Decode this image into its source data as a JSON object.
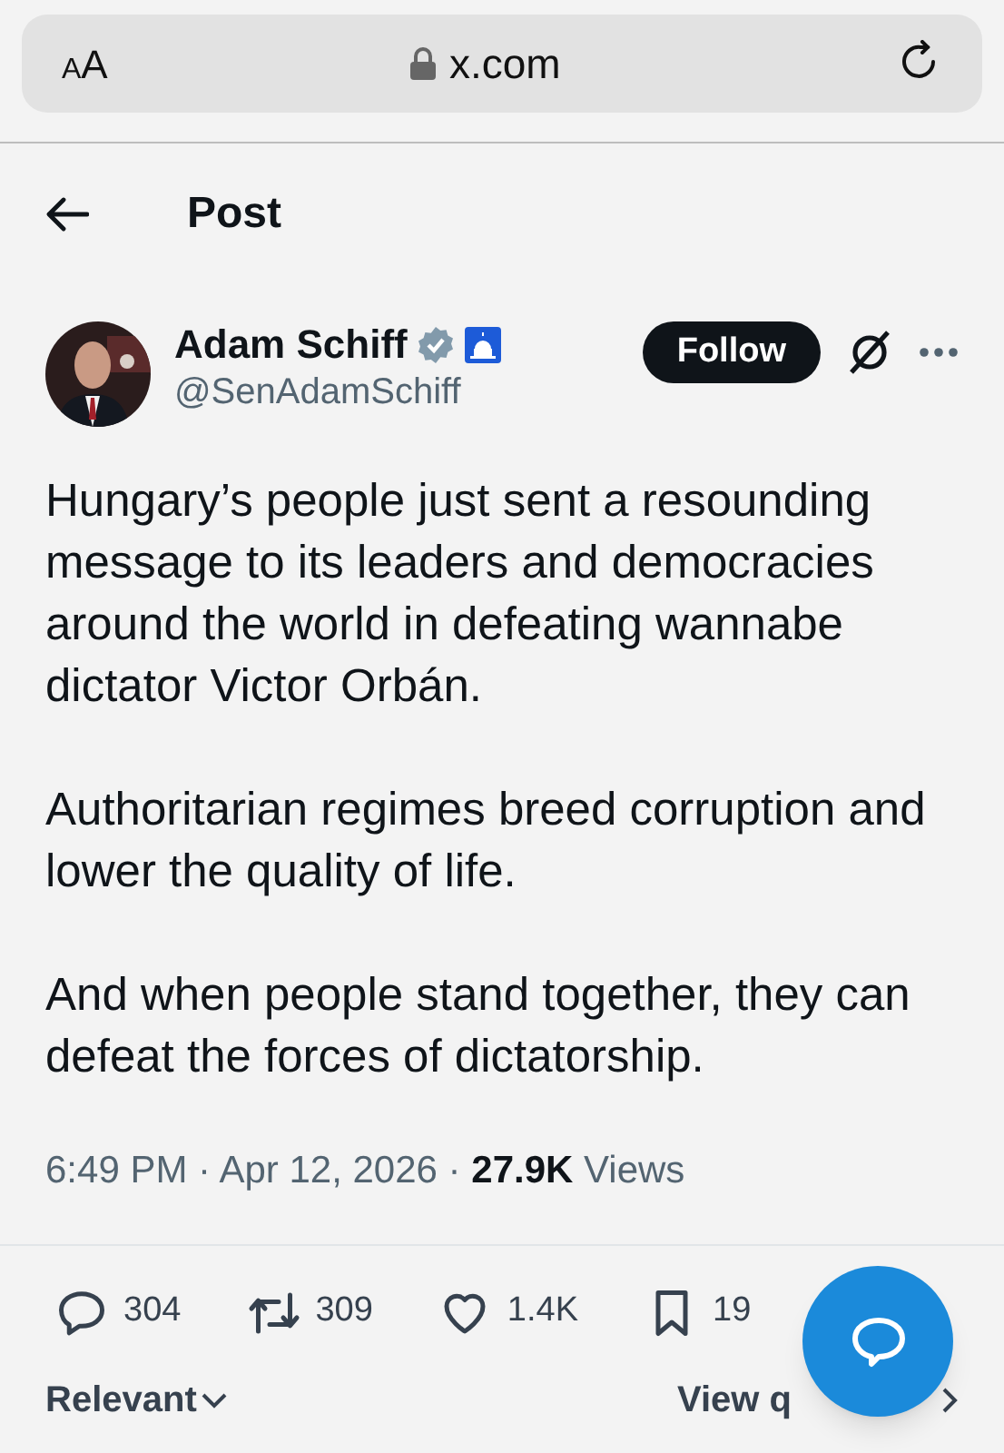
{
  "browser": {
    "text_size": "AA",
    "url": "x.com"
  },
  "header": {
    "title": "Post"
  },
  "author": {
    "name": "Adam Schiff",
    "handle": "@SenAdamSchiff",
    "follow": "Follow",
    "verified": true
  },
  "post": {
    "paragraphs": [
      "Hungary’s people just sent a resounding message to its leaders and democracies around the world in defeating wannabe dictator Victor Orbán.",
      "Authoritarian regimes breed corruption and lower the quality of life.",
      "And when people stand together, they can defeat the forces of dictatorship."
    ],
    "time": "6:49 PM · Apr 12, 2026 · ",
    "views_count": "27.9K",
    "views_label": " Views"
  },
  "actions": [
    {
      "kind": "reply",
      "count": "304"
    },
    {
      "kind": "repost",
      "count": "309"
    },
    {
      "kind": "like",
      "count": "1.4K"
    },
    {
      "kind": "bookmark",
      "count": "19"
    }
  ],
  "footer": {
    "sort": "Relevant",
    "quotes": "View q"
  }
}
